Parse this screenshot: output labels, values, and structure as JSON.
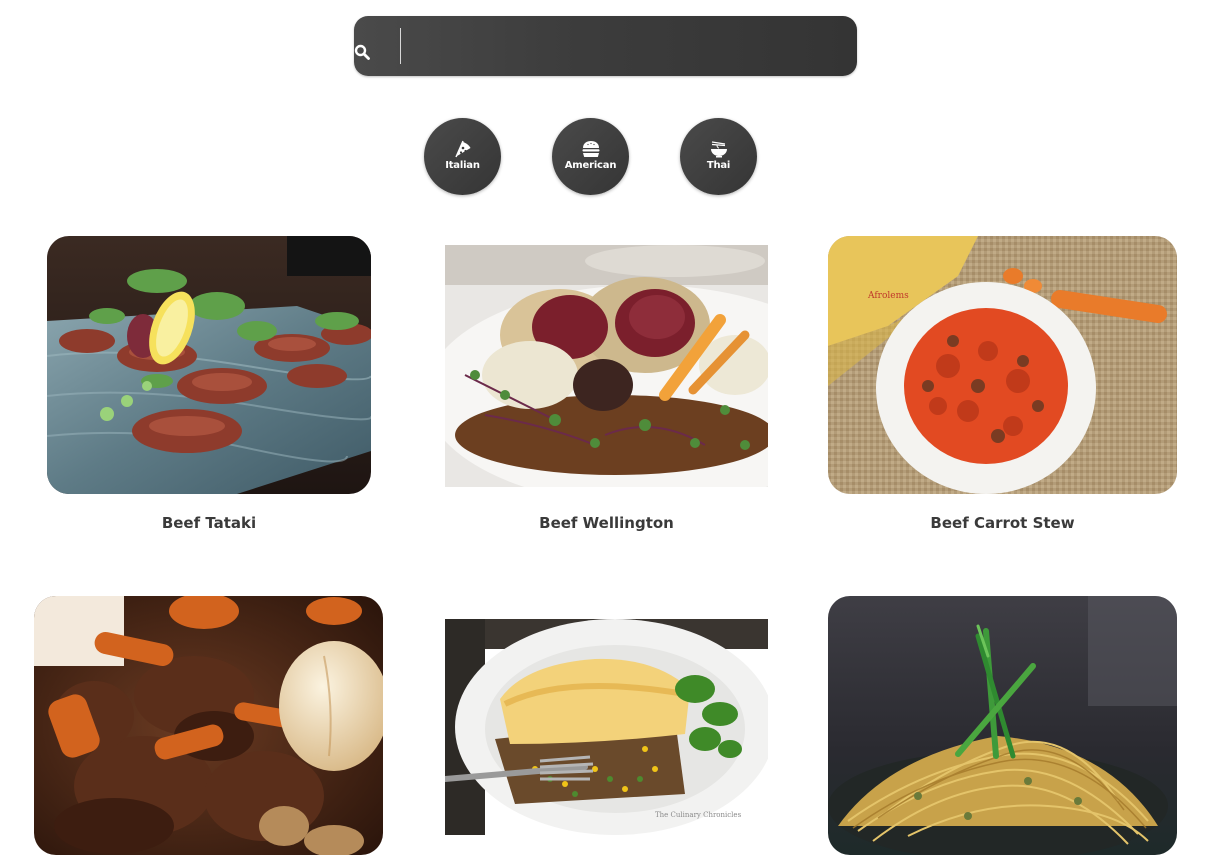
{
  "search": {
    "value": "",
    "placeholder": ""
  },
  "cuisines": [
    {
      "label": "Italian",
      "icon": "pizza-icon"
    },
    {
      "label": "American",
      "icon": "burger-icon"
    },
    {
      "label": "Thai",
      "icon": "noodle-bowl-icon"
    }
  ],
  "recipes": [
    {
      "title": "Beef Tataki",
      "image": "beef-tataki-photo"
    },
    {
      "title": "Beef Wellington",
      "image": "beef-wellington-photo"
    },
    {
      "title": "Beef Carrot Stew",
      "image": "beef-carrot-stew-photo"
    },
    {
      "title": "",
      "image": "beef-stew-closeup-photo"
    },
    {
      "title": "",
      "image": "shepherds-pie-photo"
    },
    {
      "title": "",
      "image": "noodles-photo"
    }
  ],
  "photo_captions": {
    "stew_watermark": "Afrolems",
    "pie_watermark": "The Culinary Chronicles"
  },
  "colors": {
    "dark_button": "#3c3c3c",
    "title_text": "#3a3a3a",
    "background": "#ffffff"
  }
}
